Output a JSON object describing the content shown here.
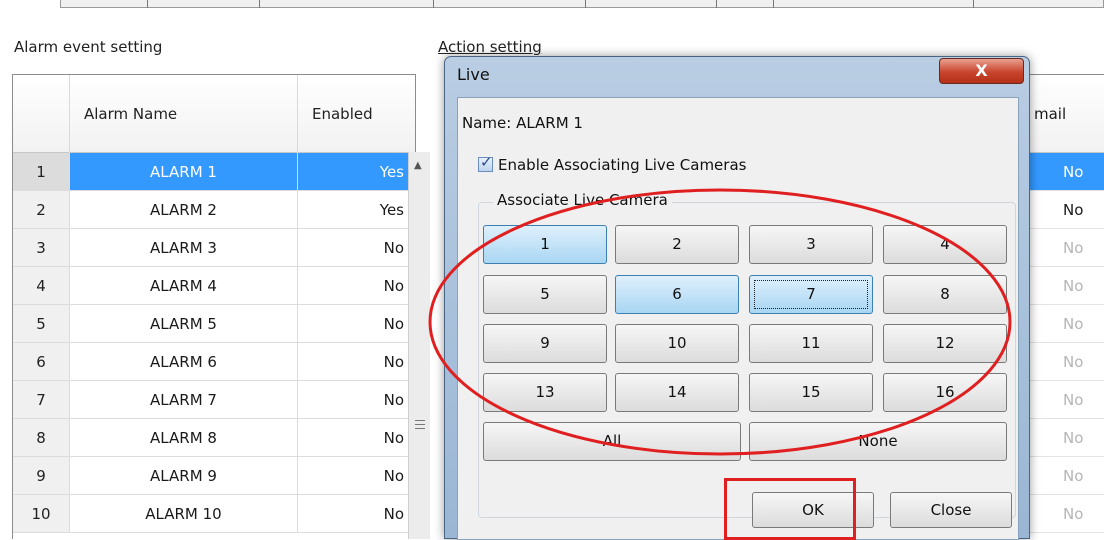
{
  "labels": {
    "alarm_event_setting": "Alarm event setting",
    "action_setting": "Action setting"
  },
  "alarm_grid": {
    "headers": {
      "name": "Alarm Name",
      "enabled": "Enabled"
    },
    "rows": [
      {
        "num": "1",
        "name": "ALARM 1",
        "enabled": "Yes"
      },
      {
        "num": "2",
        "name": "ALARM 2",
        "enabled": "Yes"
      },
      {
        "num": "3",
        "name": "ALARM 3",
        "enabled": "No"
      },
      {
        "num": "4",
        "name": "ALARM 4",
        "enabled": "No"
      },
      {
        "num": "5",
        "name": "ALARM 5",
        "enabled": "No"
      },
      {
        "num": "6",
        "name": "ALARM 6",
        "enabled": "No"
      },
      {
        "num": "7",
        "name": "ALARM 7",
        "enabled": "No"
      },
      {
        "num": "8",
        "name": "ALARM 8",
        "enabled": "No"
      },
      {
        "num": "9",
        "name": "ALARM 9",
        "enabled": "No"
      },
      {
        "num": "10",
        "name": "ALARM 10",
        "enabled": "No"
      }
    ]
  },
  "action_grid": {
    "header": "mail",
    "cells": [
      "No",
      "No",
      "No",
      "No",
      "No",
      "No",
      "No",
      "No",
      "No",
      "No"
    ]
  },
  "dialog": {
    "title": "Live",
    "close_glyph": "X",
    "name_line": "Name: ALARM  1",
    "enable_label": "Enable Associating Live Cameras",
    "group_label": "Associate Live Camera",
    "cameras": [
      "1",
      "2",
      "3",
      "4",
      "5",
      "6",
      "7",
      "8",
      "9",
      "10",
      "11",
      "12",
      "13",
      "14",
      "15",
      "16"
    ],
    "all_label": "All",
    "none_label": "None",
    "ok_label": "OK",
    "close_label": "Close"
  },
  "colors": {
    "selection": "#3399ff",
    "annotation": "#e02020"
  }
}
